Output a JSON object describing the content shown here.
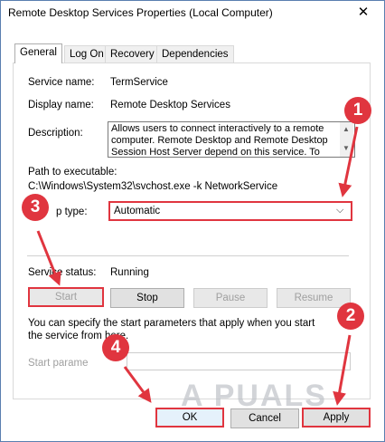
{
  "window": {
    "title": "Remote Desktop Services Properties (Local Computer)",
    "close_glyph": "✕"
  },
  "tabs": [
    {
      "label": "General",
      "active": true
    },
    {
      "label": "Log On",
      "active": false
    },
    {
      "label": "Recovery",
      "active": false
    },
    {
      "label": "Dependencies",
      "active": false
    }
  ],
  "general": {
    "service_name_label": "Service name:",
    "service_name_value": "TermService",
    "display_name_label": "Display name:",
    "display_name_value": "Remote Desktop Services",
    "description_label": "Description:",
    "description_value": "Allows users to connect interactively to a remote computer. Remote Desktop and Remote Desktop Session Host Server depend on this service. To",
    "path_label": "Path to executable:",
    "path_value": "C:\\Windows\\System32\\svchost.exe -k NetworkService",
    "startup_type_label": "Startup type:",
    "startup_type_visible": "p type:",
    "startup_type_value": "Automatic",
    "service_status_label": "Service status:",
    "service_status_value": "Running",
    "buttons": {
      "start": "Start",
      "stop": "Stop",
      "pause": "Pause",
      "resume": "Resume"
    },
    "params_help": "You can specify the start parameters that apply when you start the service from here.",
    "start_params_label": "Start parameters:",
    "start_params_visible": "Start parame"
  },
  "footer": {
    "ok": "OK",
    "cancel": "Cancel",
    "apply": "Apply"
  },
  "annotations": {
    "badge1": "1",
    "badge2": "2",
    "badge3": "3",
    "badge4": "4",
    "color": "#e0353f"
  },
  "watermark": "A  PUALS",
  "colors": {
    "highlight": "#e0353f",
    "window_border": "#5a7fb0",
    "button_face": "#e1e1e1"
  }
}
